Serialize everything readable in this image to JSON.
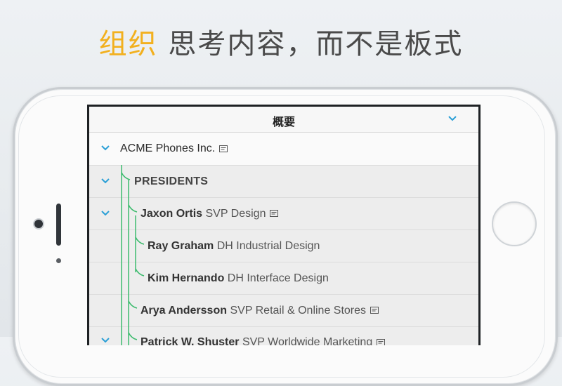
{
  "headline": {
    "accent": "组织",
    "rest": " 思考内容，而不是板式"
  },
  "nav": {
    "title": "概要"
  },
  "outline": {
    "root": {
      "name": "ACME Phones Inc."
    },
    "group": {
      "name": "PRESIDENTS"
    },
    "people": [
      {
        "name": "Jaxon Ortis",
        "role": "SVP Design"
      },
      {
        "name": "Ray Graham",
        "role": "DH Industrial Design"
      },
      {
        "name": "Kim Hernando",
        "role": "DH Interface Design"
      },
      {
        "name": "Arya Andersson",
        "role": "SVP Retail & Online Stores"
      },
      {
        "name": "Patrick W. Shuster",
        "role": "SVP Worldwide Marketing"
      }
    ]
  },
  "colors": {
    "accent": "#f2b01e",
    "chevron": "#2a9fd6",
    "tree_line": "#3dbb6e"
  }
}
